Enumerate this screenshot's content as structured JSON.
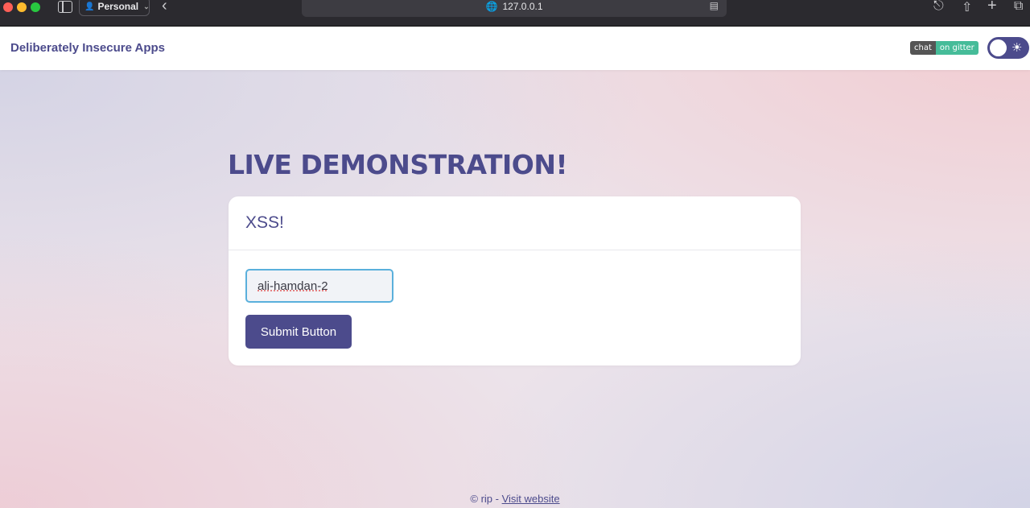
{
  "browser": {
    "profile_label": "Personal",
    "url": "127.0.0.1"
  },
  "navbar": {
    "brand": "Deliberately Insecure Apps",
    "gitter_left": "chat",
    "gitter_right": "on gitter"
  },
  "main": {
    "heading": "LIVE DEMONSTRATION!",
    "card_title": "XSS!",
    "input_value": "ali-hamdan-2",
    "submit_label": "Submit Button"
  },
  "footer": {
    "prefix": "© rip - ",
    "link_text": "Visit website"
  }
}
